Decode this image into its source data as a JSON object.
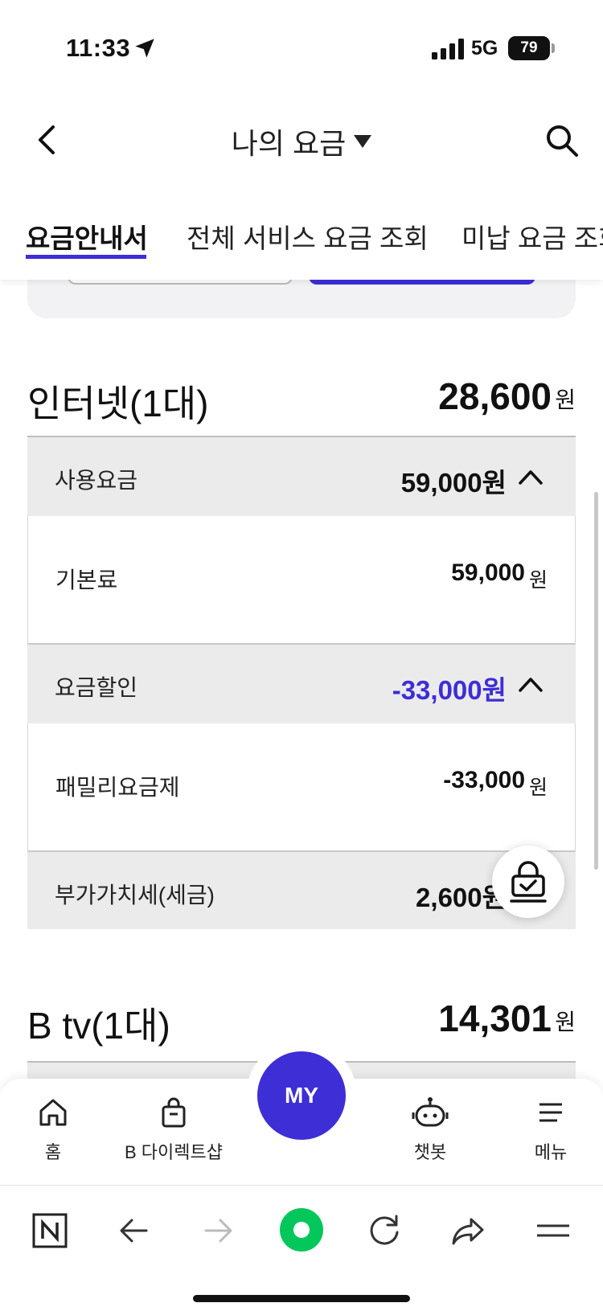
{
  "status_bar": {
    "time": "11:33",
    "network": "5G",
    "battery": "79"
  },
  "header": {
    "title": "나의 요금"
  },
  "tabs": [
    {
      "label": "요금안내서",
      "active": true
    },
    {
      "label": "전체 서비스 요금 조회",
      "active": false
    },
    {
      "label": "미납 요금 조회",
      "active": false
    }
  ],
  "internet": {
    "title": "인터넷(1대)",
    "total": "28,600",
    "unit": "원",
    "usage_label": "사용요금",
    "usage_amount": "59,000원",
    "basic_label": "기본료",
    "basic_amount": "59,000",
    "basic_unit": "원",
    "discount_label": "요금할인",
    "discount_amount": "-33,000원",
    "family_label": "패밀리요금제",
    "family_amount": "-33,000",
    "family_unit": "원",
    "vat_label": "부가가치세(세금)",
    "vat_amount": "2,600원"
  },
  "btv": {
    "title": "B tv(1대)",
    "total": "14,301",
    "unit": "원"
  },
  "bottom_nav": {
    "home": "홈",
    "shop": "B 다이렉트샵",
    "my": "MY",
    "chatbot": "챗봇",
    "menu": "메뉴"
  },
  "colors": {
    "accent": "#3d2ed6",
    "discount": "#3d2ed6",
    "naver_green": "#03c75a"
  }
}
